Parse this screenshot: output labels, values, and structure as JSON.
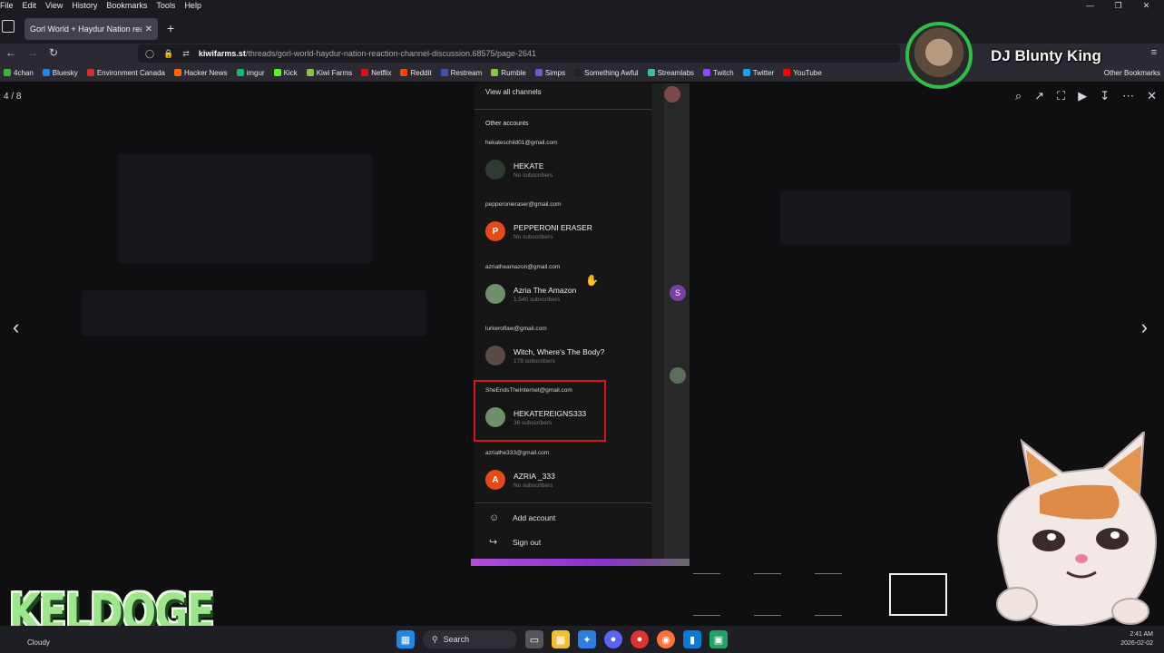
{
  "menubar": {
    "items": [
      "File",
      "Edit",
      "View",
      "History",
      "Bookmarks",
      "Tools",
      "Help"
    ]
  },
  "tab": {
    "title": "Gorl World + Haydur Nation reactic"
  },
  "url": {
    "host": "kiwifarms.st",
    "path": "/threads/gorl-world-haydur-nation-reaction-channel-discussion.68575/page-2641"
  },
  "bookmarks": [
    {
      "label": "4chan",
      "color": "#3fae3f"
    },
    {
      "label": "Bluesky",
      "color": "#1e88e5"
    },
    {
      "label": "Environment Canada",
      "color": "#d32f2f"
    },
    {
      "label": "Hacker News",
      "color": "#ff6600"
    },
    {
      "label": "imgur",
      "color": "#1bb76e"
    },
    {
      "label": "Kick",
      "color": "#53fc18"
    },
    {
      "label": "Kiwi Farms",
      "color": "#8bc34a"
    },
    {
      "label": "Netflix",
      "color": "#e50914"
    },
    {
      "label": "Reddit",
      "color": "#ff4500"
    },
    {
      "label": "Restream",
      "color": "#3f51b5"
    },
    {
      "label": "Rumble",
      "color": "#85c742"
    },
    {
      "label": "Simps",
      "color": "#6a5acd"
    },
    {
      "label": "Something Awful",
      "color": "#222222"
    },
    {
      "label": "Streamlabs",
      "color": "#31c3a2"
    },
    {
      "label": "Twitch",
      "color": "#9146ff"
    },
    {
      "label": "Twitter",
      "color": "#1da1f2"
    },
    {
      "label": "YouTube",
      "color": "#ff0000"
    }
  ],
  "other_bookmarks": "Other Bookmarks",
  "lightbox": {
    "counter": "4 / 8"
  },
  "panel": {
    "view_all": "View all channels",
    "other_accounts": "Other accounts",
    "accounts": [
      {
        "email": "hekateschild01@gmail.com",
        "name": "HEKATE",
        "subs": "No subscribers",
        "avatar_letter": "",
        "avatar_color": "#2f3a33"
      },
      {
        "email": "pepperonieraser@gmail.com",
        "name": "PEPPERONI ERASER",
        "subs": "No subscribers",
        "avatar_letter": "P",
        "avatar_color": "#e64a19"
      },
      {
        "email": "azriatheamazon@gmail.com",
        "name": "Azria The Amazon",
        "subs": "1,540 subscribers",
        "avatar_letter": "",
        "avatar_color": "#6d8f6a"
      },
      {
        "email": "lurkeroflaw@gmail.com",
        "name": "Witch, Where's The Body?",
        "subs": "178 subscribers",
        "avatar_letter": "",
        "avatar_color": "#5a4a44"
      },
      {
        "email": "SheEndsTheInternet@gmail.com",
        "name": "HEKATEREIGNS333",
        "subs": "36 subscribers",
        "avatar_letter": "",
        "avatar_color": "#6d8f6a"
      },
      {
        "email": "azriathe333@gmail.com",
        "name": "AZRIA _333",
        "subs": "No subscribers",
        "avatar_letter": "A",
        "avatar_color": "#e64a19"
      }
    ],
    "add_account": "Add account",
    "sign_out": "Sign out",
    "side_avatar_letter": "S"
  },
  "overlay": {
    "streamer_name": "DJ Blunty King",
    "brand": "KELDOGE"
  },
  "taskbar": {
    "weather": "Cloudy",
    "search": "Search",
    "time": "2:41 AM",
    "date": "2026-02-02"
  }
}
